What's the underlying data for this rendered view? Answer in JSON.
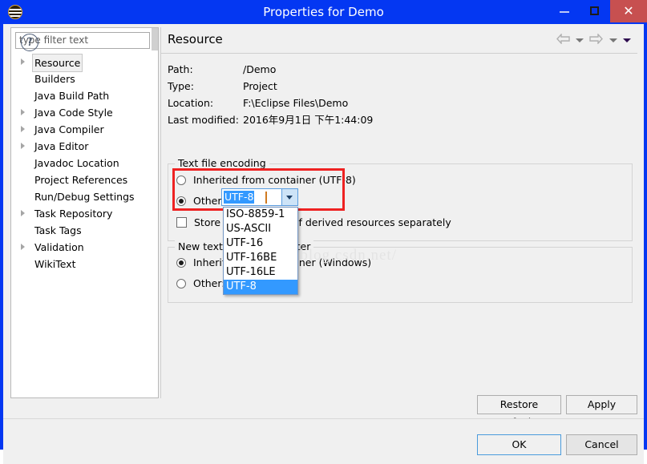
{
  "window": {
    "title": "Properties for Demo",
    "icon": "eclipse-icon",
    "minimize_label": "",
    "maximize_label": "",
    "close_label": "✕"
  },
  "sidebar": {
    "filter_placeholder": "type filter text",
    "filter_value": "",
    "items": [
      {
        "label": "Resource",
        "expandable": true,
        "selected": true
      },
      {
        "label": "Builders",
        "expandable": false,
        "selected": false
      },
      {
        "label": "Java Build Path",
        "expandable": false,
        "selected": false
      },
      {
        "label": "Java Code Style",
        "expandable": true,
        "selected": false
      },
      {
        "label": "Java Compiler",
        "expandable": true,
        "selected": false
      },
      {
        "label": "Java Editor",
        "expandable": true,
        "selected": false
      },
      {
        "label": "Javadoc Location",
        "expandable": false,
        "selected": false
      },
      {
        "label": "Project References",
        "expandable": false,
        "selected": false
      },
      {
        "label": "Run/Debug Settings",
        "expandable": false,
        "selected": false
      },
      {
        "label": "Task Repository",
        "expandable": true,
        "selected": false
      },
      {
        "label": "Task Tags",
        "expandable": false,
        "selected": false
      },
      {
        "label": "Validation",
        "expandable": true,
        "selected": false
      },
      {
        "label": "WikiText",
        "expandable": false,
        "selected": false
      }
    ]
  },
  "content": {
    "title": "Resource",
    "nav": {
      "back_icon": "arrow-left-icon",
      "back_menu_icon": "chevron-down-icon",
      "forward_icon": "arrow-right-icon",
      "forward_menu_icon": "chevron-down-icon",
      "menu_icon": "chevron-down-icon"
    },
    "info": [
      {
        "key": "Path:",
        "value": "/Demo"
      },
      {
        "key": "Type:",
        "value": "Project"
      },
      {
        "key": "Location:",
        "value": "F:\\Eclipse Files\\Demo"
      },
      {
        "key": "Last modified:",
        "value": "2016年9月1日 下午1:44:09"
      }
    ],
    "encoding_group": {
      "legend": "Text file encoding",
      "inherited_label": "Inherited from container (UTF-8)",
      "inherited_selected": false,
      "other_label": "Other:",
      "other_selected": true,
      "combo_value": "UTF-8",
      "combo_arrow_icon": "chevron-down-icon",
      "store_separately_label": "Store the encoding of derived resources separately",
      "store_separately_checked": false,
      "dropdown_options": [
        "ISO-8859-1",
        "US-ASCII",
        "UTF-16",
        "UTF-16BE",
        "UTF-16LE",
        "UTF-8"
      ],
      "dropdown_selected": "UTF-8"
    },
    "delimiter_group": {
      "legend": "New text file line delimiter",
      "inherited_label": "Inherited from container (Windows)",
      "inherited_selected": true,
      "other_label": "Other:",
      "other_selected": false
    },
    "restore_defaults_label": "Restore Defaults",
    "apply_label": "Apply"
  },
  "footer": {
    "help_icon": "question-mark-icon",
    "help_label": "?",
    "ok_label": "OK",
    "cancel_label": "Cancel"
  },
  "watermark": "http://blog.csdn.net/",
  "colors": {
    "titlebar": "#0437f2",
    "close_button": "#c75050",
    "highlight_box": "#ee2222",
    "selection": "#3399ff",
    "panel": "#f0f0f0"
  }
}
